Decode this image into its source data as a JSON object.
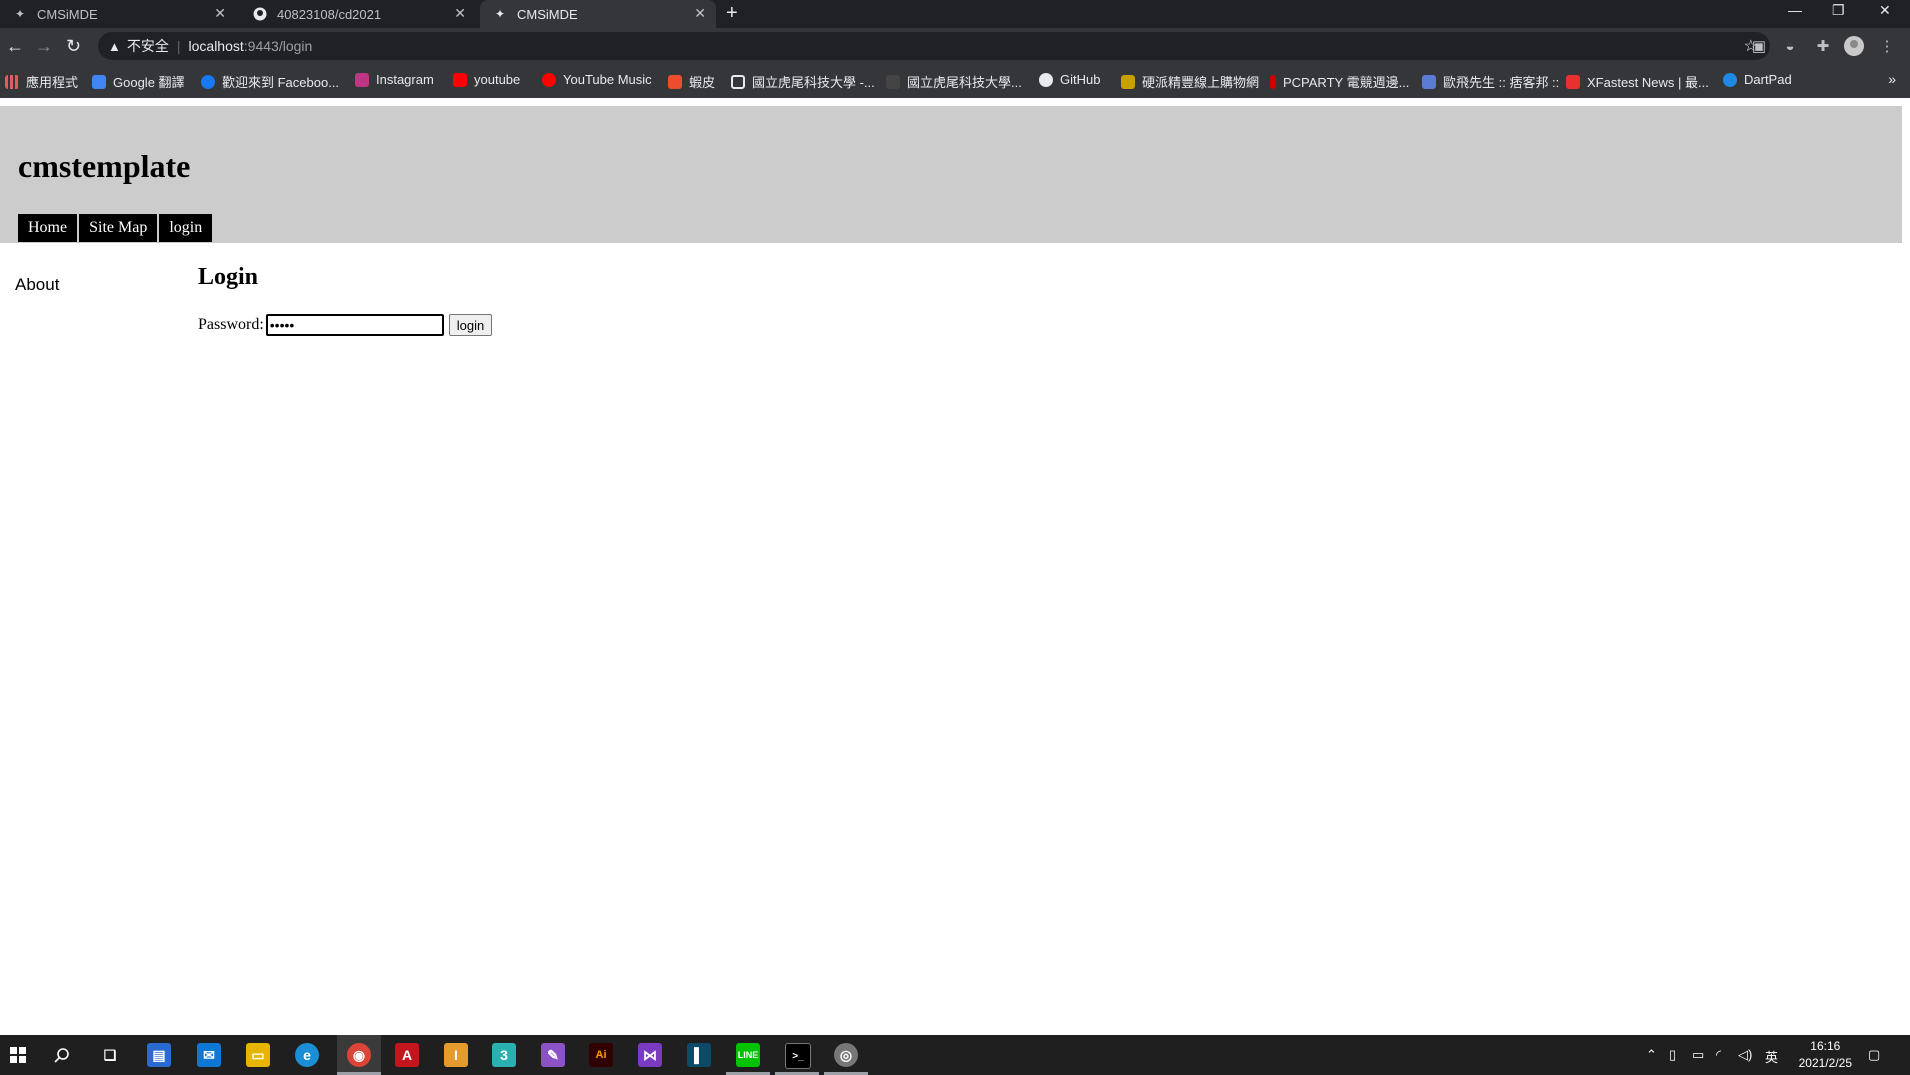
{
  "browser": {
    "tabs": [
      {
        "title": "CMSiMDE",
        "favicon": "cmsimde-icon"
      },
      {
        "title": "40823108/cd2021",
        "favicon": "github-icon"
      },
      {
        "title": "CMSiMDE",
        "favicon": "cmsimde-icon"
      }
    ],
    "address": {
      "security": "不安全",
      "host": "localhost",
      "path": ":9443/login"
    },
    "bookmarks": [
      {
        "label": "應用程式",
        "color": "#e8eaed"
      },
      {
        "label": "Google 翻譯",
        "color": "#4285f4"
      },
      {
        "label": "歡迎來到 Faceboo...",
        "color": "#1877f2"
      },
      {
        "label": "Instagram",
        "color": "#c13584"
      },
      {
        "label": "youtube",
        "color": "#ff0000"
      },
      {
        "label": "YouTube Music",
        "color": "#ff0000"
      },
      {
        "label": "蝦皮",
        "color": "#ee4d2d"
      },
      {
        "label": "國立虎尾科技大學 -...",
        "color": "#e8eaed"
      },
      {
        "label": "國立虎尾科技大學...",
        "color": "#e8eaed"
      },
      {
        "label": "GitHub",
        "color": "#e8eaed"
      },
      {
        "label": "硬派精豐線上購物網",
        "color": "#c8a000"
      },
      {
        "label": "PCPARTY 電競週邊...",
        "color": "#d00000"
      },
      {
        "label": "歐飛先生 :: 痞客邦 ::",
        "color": "#5b7bd5"
      },
      {
        "label": "XFastest News | 最...",
        "color": "#e8312f"
      },
      {
        "label": "DartPad",
        "color": "#1e88e5"
      }
    ]
  },
  "site": {
    "title": "cmstemplate",
    "menu": [
      "Home",
      "Site Map",
      "login"
    ],
    "sidebar": [
      "About"
    ]
  },
  "login": {
    "heading": "Login",
    "password_label": "Password:",
    "password_value": "•••••",
    "button": "login"
  },
  "taskbar": {
    "time": "16:16",
    "date": "2021/2/25",
    "ime": "英"
  }
}
